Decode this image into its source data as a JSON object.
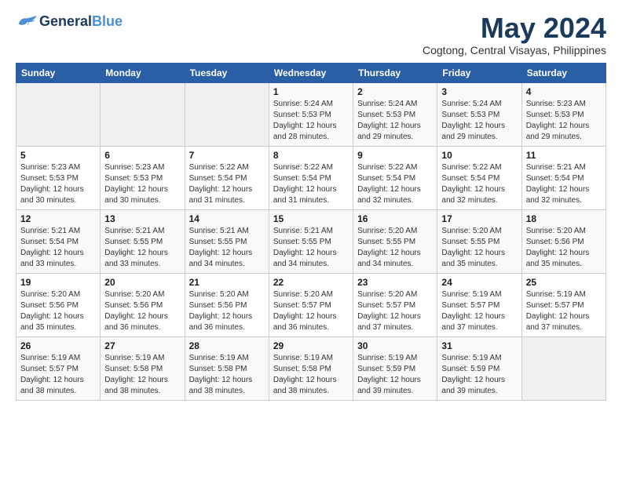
{
  "app": {
    "name_part1": "General",
    "name_part2": "Blue"
  },
  "header": {
    "month_year": "May 2024",
    "location": "Cogtong, Central Visayas, Philippines"
  },
  "weekdays": [
    "Sunday",
    "Monday",
    "Tuesday",
    "Wednesday",
    "Thursday",
    "Friday",
    "Saturday"
  ],
  "weeks": [
    [
      {
        "day": "",
        "info": ""
      },
      {
        "day": "",
        "info": ""
      },
      {
        "day": "",
        "info": ""
      },
      {
        "day": "1",
        "info": "Sunrise: 5:24 AM\nSunset: 5:53 PM\nDaylight: 12 hours\nand 28 minutes."
      },
      {
        "day": "2",
        "info": "Sunrise: 5:24 AM\nSunset: 5:53 PM\nDaylight: 12 hours\nand 29 minutes."
      },
      {
        "day": "3",
        "info": "Sunrise: 5:24 AM\nSunset: 5:53 PM\nDaylight: 12 hours\nand 29 minutes."
      },
      {
        "day": "4",
        "info": "Sunrise: 5:23 AM\nSunset: 5:53 PM\nDaylight: 12 hours\nand 29 minutes."
      }
    ],
    [
      {
        "day": "5",
        "info": "Sunrise: 5:23 AM\nSunset: 5:53 PM\nDaylight: 12 hours\nand 30 minutes."
      },
      {
        "day": "6",
        "info": "Sunrise: 5:23 AM\nSunset: 5:53 PM\nDaylight: 12 hours\nand 30 minutes."
      },
      {
        "day": "7",
        "info": "Sunrise: 5:22 AM\nSunset: 5:54 PM\nDaylight: 12 hours\nand 31 minutes."
      },
      {
        "day": "8",
        "info": "Sunrise: 5:22 AM\nSunset: 5:54 PM\nDaylight: 12 hours\nand 31 minutes."
      },
      {
        "day": "9",
        "info": "Sunrise: 5:22 AM\nSunset: 5:54 PM\nDaylight: 12 hours\nand 32 minutes."
      },
      {
        "day": "10",
        "info": "Sunrise: 5:22 AM\nSunset: 5:54 PM\nDaylight: 12 hours\nand 32 minutes."
      },
      {
        "day": "11",
        "info": "Sunrise: 5:21 AM\nSunset: 5:54 PM\nDaylight: 12 hours\nand 32 minutes."
      }
    ],
    [
      {
        "day": "12",
        "info": "Sunrise: 5:21 AM\nSunset: 5:54 PM\nDaylight: 12 hours\nand 33 minutes."
      },
      {
        "day": "13",
        "info": "Sunrise: 5:21 AM\nSunset: 5:55 PM\nDaylight: 12 hours\nand 33 minutes."
      },
      {
        "day": "14",
        "info": "Sunrise: 5:21 AM\nSunset: 5:55 PM\nDaylight: 12 hours\nand 34 minutes."
      },
      {
        "day": "15",
        "info": "Sunrise: 5:21 AM\nSunset: 5:55 PM\nDaylight: 12 hours\nand 34 minutes."
      },
      {
        "day": "16",
        "info": "Sunrise: 5:20 AM\nSunset: 5:55 PM\nDaylight: 12 hours\nand 34 minutes."
      },
      {
        "day": "17",
        "info": "Sunrise: 5:20 AM\nSunset: 5:55 PM\nDaylight: 12 hours\nand 35 minutes."
      },
      {
        "day": "18",
        "info": "Sunrise: 5:20 AM\nSunset: 5:56 PM\nDaylight: 12 hours\nand 35 minutes."
      }
    ],
    [
      {
        "day": "19",
        "info": "Sunrise: 5:20 AM\nSunset: 5:56 PM\nDaylight: 12 hours\nand 35 minutes."
      },
      {
        "day": "20",
        "info": "Sunrise: 5:20 AM\nSunset: 5:56 PM\nDaylight: 12 hours\nand 36 minutes."
      },
      {
        "day": "21",
        "info": "Sunrise: 5:20 AM\nSunset: 5:56 PM\nDaylight: 12 hours\nand 36 minutes."
      },
      {
        "day": "22",
        "info": "Sunrise: 5:20 AM\nSunset: 5:57 PM\nDaylight: 12 hours\nand 36 minutes."
      },
      {
        "day": "23",
        "info": "Sunrise: 5:20 AM\nSunset: 5:57 PM\nDaylight: 12 hours\nand 37 minutes."
      },
      {
        "day": "24",
        "info": "Sunrise: 5:19 AM\nSunset: 5:57 PM\nDaylight: 12 hours\nand 37 minutes."
      },
      {
        "day": "25",
        "info": "Sunrise: 5:19 AM\nSunset: 5:57 PM\nDaylight: 12 hours\nand 37 minutes."
      }
    ],
    [
      {
        "day": "26",
        "info": "Sunrise: 5:19 AM\nSunset: 5:57 PM\nDaylight: 12 hours\nand 38 minutes."
      },
      {
        "day": "27",
        "info": "Sunrise: 5:19 AM\nSunset: 5:58 PM\nDaylight: 12 hours\nand 38 minutes."
      },
      {
        "day": "28",
        "info": "Sunrise: 5:19 AM\nSunset: 5:58 PM\nDaylight: 12 hours\nand 38 minutes."
      },
      {
        "day": "29",
        "info": "Sunrise: 5:19 AM\nSunset: 5:58 PM\nDaylight: 12 hours\nand 38 minutes."
      },
      {
        "day": "30",
        "info": "Sunrise: 5:19 AM\nSunset: 5:59 PM\nDaylight: 12 hours\nand 39 minutes."
      },
      {
        "day": "31",
        "info": "Sunrise: 5:19 AM\nSunset: 5:59 PM\nDaylight: 12 hours\nand 39 minutes."
      },
      {
        "day": "",
        "info": ""
      }
    ]
  ]
}
